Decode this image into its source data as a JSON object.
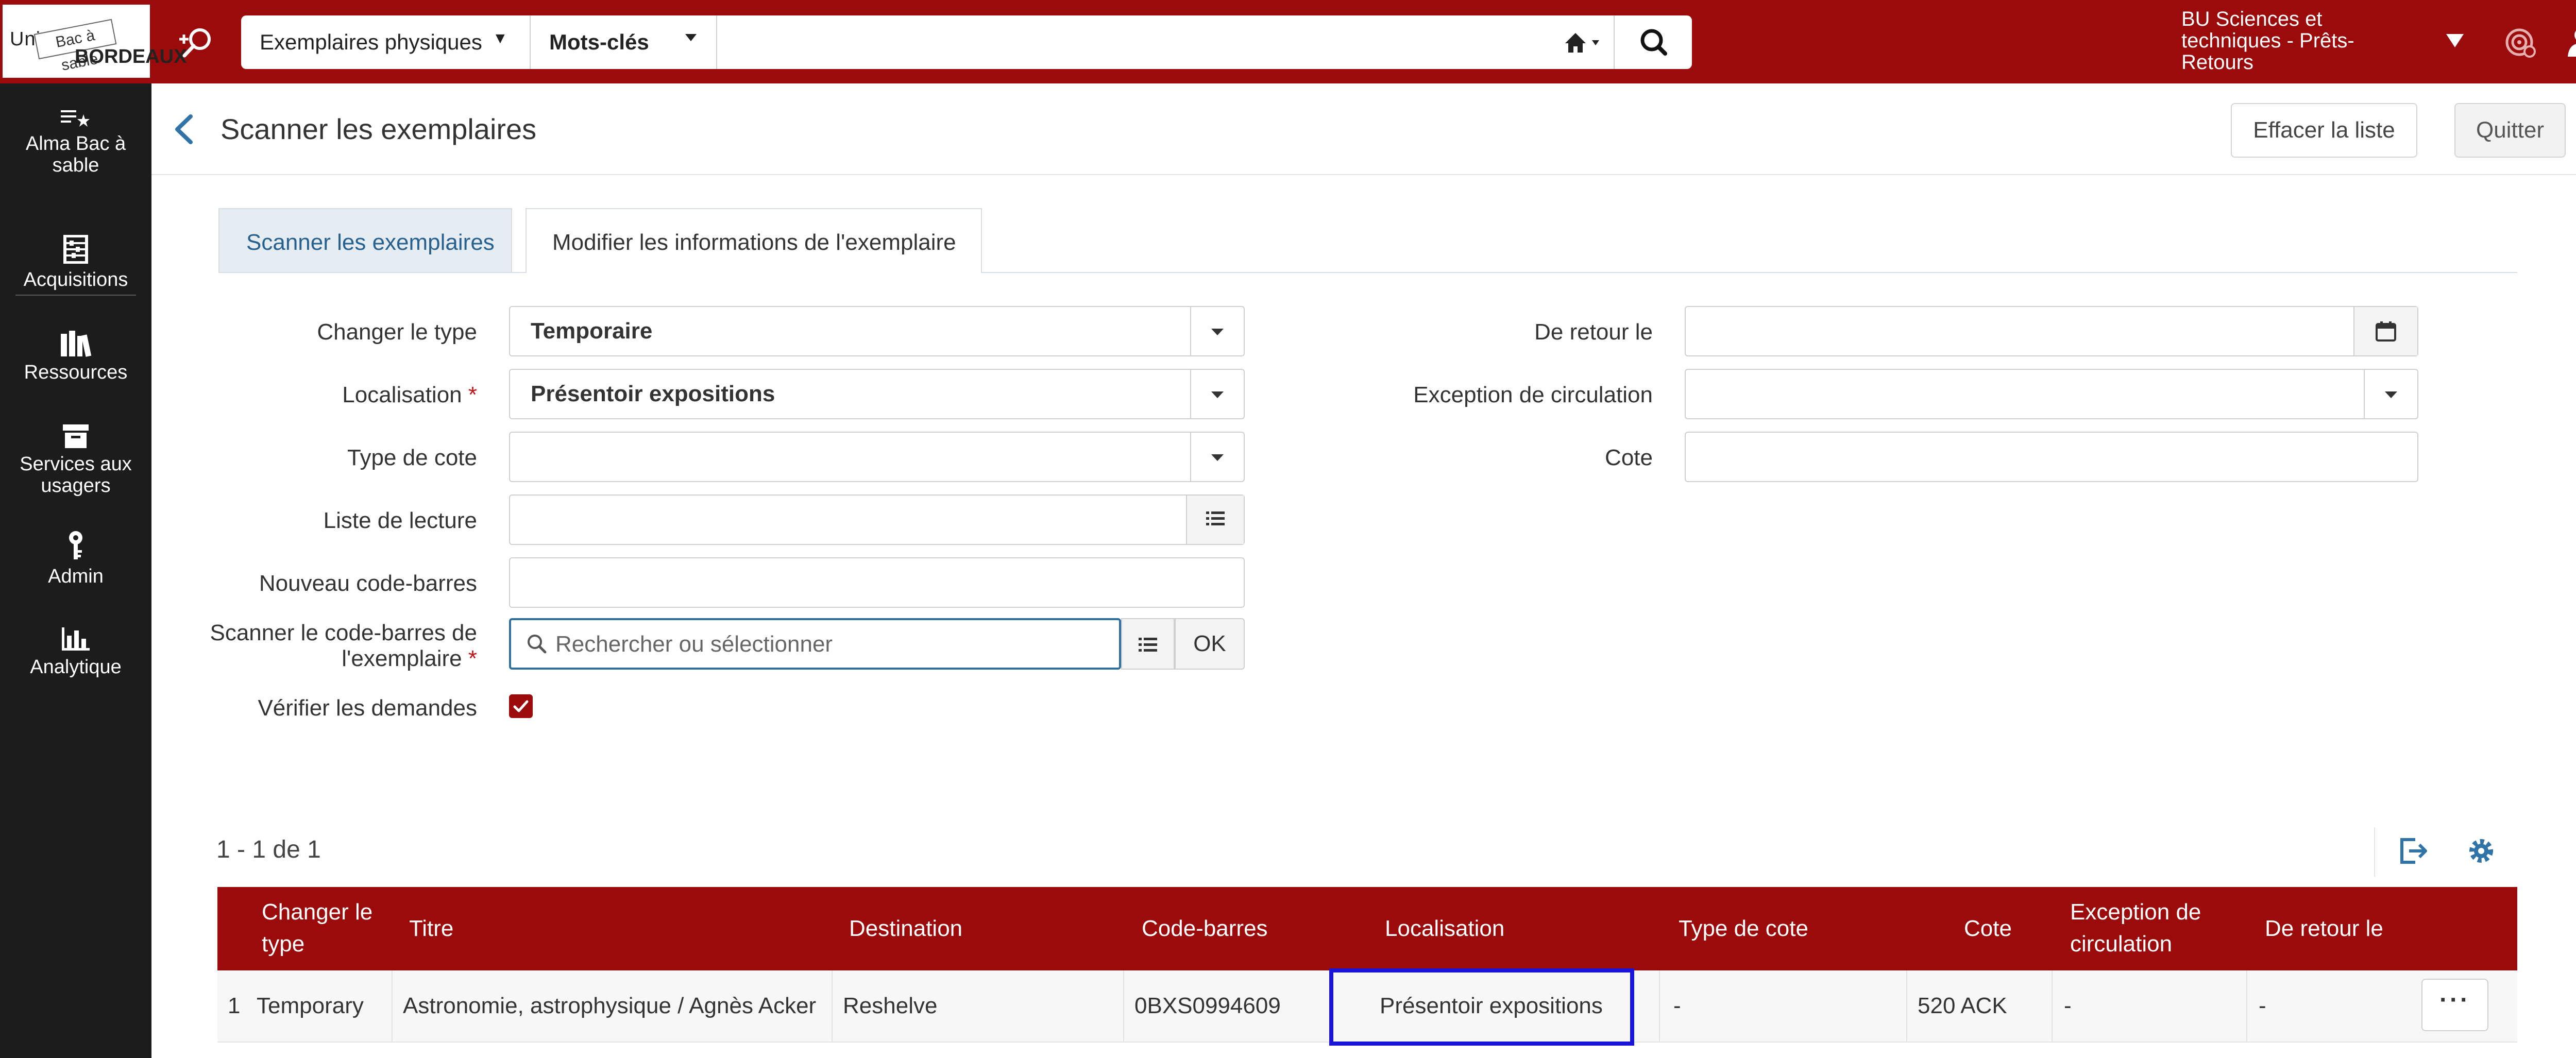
{
  "logo": {
    "line1": "Univ",
    "tag": "Bac à sable",
    "line2": "BORDEAUX"
  },
  "topbar": {
    "scope": "Exemplaires physiques",
    "field": "Mots-clés",
    "search_value": "",
    "location": "BU Sciences et techniques - Prêts-Retours",
    "bg_color": "#9b0b0b"
  },
  "nav": {
    "items": [
      {
        "label": "Alma Bac à sable",
        "icon": "list-star-icon"
      },
      {
        "label": "Acquisitions",
        "icon": "abacus-icon"
      },
      {
        "label": "Ressources",
        "icon": "books-icon"
      },
      {
        "label": "Services aux usagers",
        "icon": "box-icon"
      },
      {
        "label": "Admin",
        "icon": "key-icon"
      },
      {
        "label": "Analytique",
        "icon": "bar-chart-icon"
      }
    ]
  },
  "page": {
    "title": "Scanner les exemplaires",
    "clear_label": "Effacer la liste",
    "quit_label": "Quitter"
  },
  "tabs": [
    {
      "label": "Scanner les exemplaires",
      "active": false
    },
    {
      "label": "Modifier les informations de l'exemplaire",
      "active": true
    }
  ],
  "form": {
    "type_change": {
      "label": "Changer le type",
      "value": "Temporaire"
    },
    "location": {
      "label": "Localisation",
      "value": "Présentoir expositions"
    },
    "call_type": {
      "label": "Type de cote",
      "value": ""
    },
    "reading_list": {
      "label": "Liste de lecture",
      "value": ""
    },
    "new_barcode": {
      "label": "Nouveau code-barres",
      "value": ""
    },
    "scan_barcode": {
      "label_line1": "Scanner le code-barres de",
      "label_line2": "l'exemplaire",
      "placeholder": "Rechercher ou sélectionner",
      "ok_label": "OK"
    },
    "verify_requests": {
      "label": "Vérifier les demandes",
      "checked": true
    },
    "due_back": {
      "label": "De retour le",
      "value": ""
    },
    "circ_exception": {
      "label": "Exception de circulation",
      "value": ""
    },
    "call_number": {
      "label": "Cote",
      "value": ""
    }
  },
  "results": {
    "count_label": "1 - 1 de 1",
    "columns": {
      "type_line1": "Changer le",
      "type_line2": "type",
      "title": "Titre",
      "destination": "Destination",
      "barcode": "Code-barres",
      "location": "Localisation",
      "call_type": "Type de cote",
      "call_number": "Cote",
      "exception_line1": "Exception de",
      "exception_line2": "circulation",
      "due_back": "De retour le"
    },
    "rows": [
      {
        "index": "1",
        "type": "Temporary",
        "title": "Astronomie, astrophysique / Agnès Acker",
        "destination": "Reshelve",
        "barcode": "0BXS0994609",
        "location": "Présentoir expositions",
        "call_type": "-",
        "call_number": "520 ACK",
        "exception": "-",
        "due_back": "-",
        "actions": "···"
      }
    ],
    "header_color": "#9b0b0b",
    "highlight_color": "#1a14d8"
  }
}
